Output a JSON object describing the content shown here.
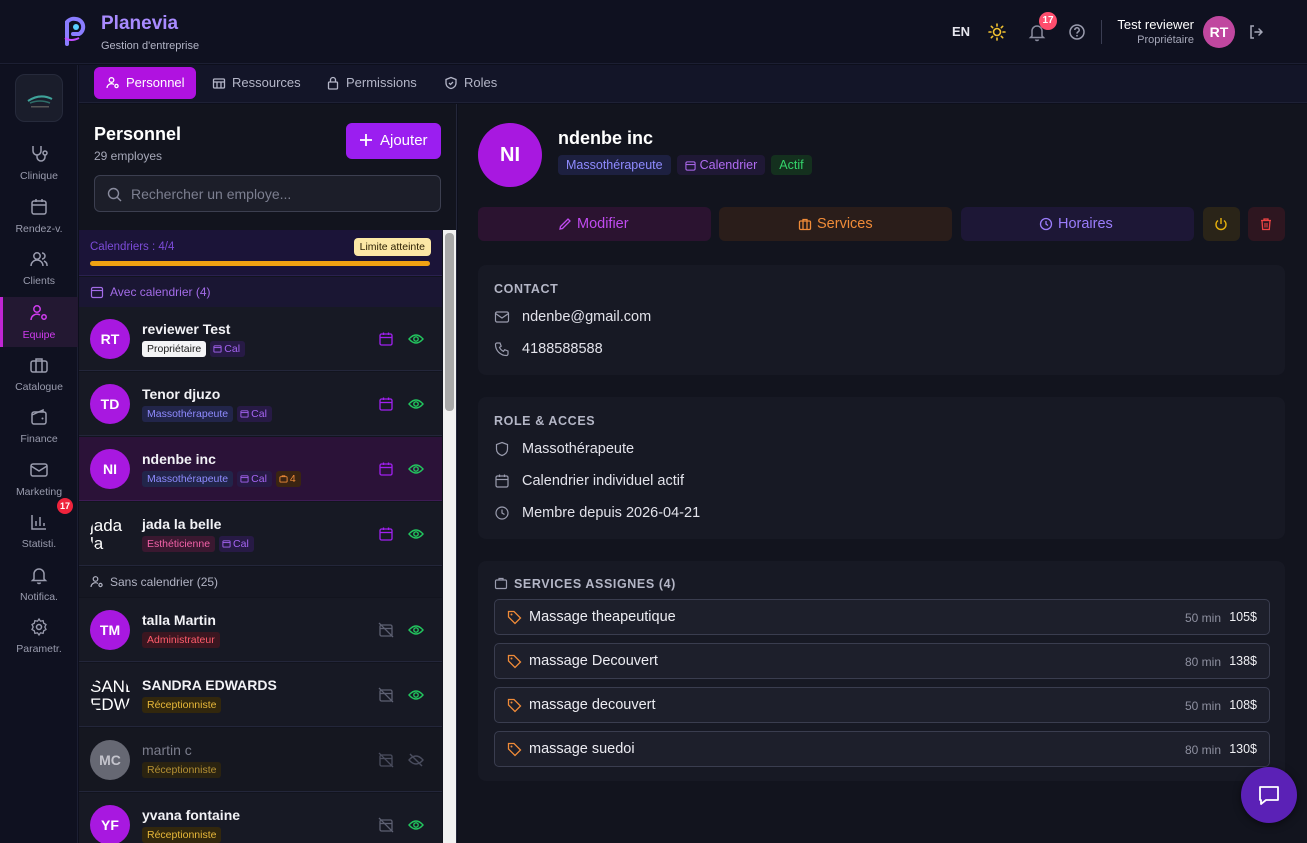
{
  "app": {
    "brand_name": "Planevia",
    "brand_sub": "Gestion d'entreprise"
  },
  "topbar": {
    "lang": "EN",
    "notif_count": "17",
    "user_name": "Test reviewer",
    "user_role": "Propriétaire",
    "user_initials": "RT"
  },
  "leftnav": {
    "items": [
      {
        "label": "Clinique",
        "icon": "stethoscope-icon"
      },
      {
        "label": "Rendez-v.",
        "icon": "calendar-icon"
      },
      {
        "label": "Clients",
        "icon": "users-icon"
      },
      {
        "label": "Equipe",
        "icon": "team-gear-icon"
      },
      {
        "label": "Catalogue",
        "icon": "briefcase-icon"
      },
      {
        "label": "Finance",
        "icon": "wallet-icon"
      },
      {
        "label": "Marketing",
        "icon": "mail-icon"
      },
      {
        "label": "Statisti.",
        "icon": "bar-chart-icon"
      },
      {
        "label": "Notifica.",
        "icon": "bell-icon"
      },
      {
        "label": "Parametr.",
        "icon": "gear-icon"
      }
    ],
    "notif_badge": "17",
    "active": "Equipe"
  },
  "tabs": [
    {
      "label": "Personnel",
      "icon": "user-gear-icon",
      "active": true
    },
    {
      "label": "Ressources",
      "icon": "building-icon",
      "active": false
    },
    {
      "label": "Permissions",
      "icon": "lock-icon",
      "active": false
    },
    {
      "label": "Roles",
      "icon": "shield-icon",
      "active": false
    }
  ],
  "list": {
    "title": "Personnel",
    "count": "29 employes",
    "add_label": "Ajouter",
    "search_placeholder": "Rechercher un employe...",
    "cal_limit_text": "Calendriers : 4/4",
    "cal_limit_badge": "Limite atteinte",
    "cal_limit_fill": 1.0,
    "section_cal": "Avec calendrier (4)",
    "section_nocal": "Sans calendrier (25)",
    "cal_tag": "Cal",
    "employees_cal": [
      {
        "initials": "RT",
        "name": "reviewer Test",
        "role": "Propriétaire",
        "svc": ""
      },
      {
        "initials": "TD",
        "name": "Tenor djuzo",
        "role": "Massothérapeute",
        "svc": ""
      },
      {
        "initials": "NI",
        "name": "ndenbe inc",
        "role": "Massothérapeute",
        "svc": "4"
      },
      {
        "initials": "jada la belle",
        "name": "jada la belle",
        "role": "Esthéticienne",
        "svc": ""
      }
    ],
    "employees_nocal": [
      {
        "initials": "TM",
        "name": "talla Martin",
        "role": "Administrateur"
      },
      {
        "initials": "SANDRA EDWARDS",
        "name": "SANDRA EDWARDS",
        "role": "Réceptionniste"
      },
      {
        "initials": "MC",
        "name": "martin c",
        "role": "Réceptionniste"
      },
      {
        "initials": "YF",
        "name": "yvana fontaine",
        "role": "Réceptionniste"
      }
    ]
  },
  "detail": {
    "initials": "NI",
    "name": "ndenbe inc",
    "role_tag": "Massothérapeute",
    "cal_tag": "Calendrier",
    "status_tag": "Actif",
    "btn_edit": "Modifier",
    "btn_services": "Services",
    "btn_hours": "Horaires",
    "contact_heading": "CONTACT",
    "email": "ndenbe@gmail.com",
    "phone": "4188588588",
    "role_heading": "ROLE & ACCES",
    "role": "Massothérapeute",
    "calendar_status": "Calendrier individuel actif",
    "member_since": "Membre depuis 2026-04-21",
    "services_heading": "SERVICES ASSIGNES (4)",
    "services": [
      {
        "name": "Massage theapeutique",
        "duration": "50 min",
        "price": "105$"
      },
      {
        "name": "massage Decouvert",
        "duration": "80 min",
        "price": "138$"
      },
      {
        "name": "massage decouvert",
        "duration": "50 min",
        "price": "108$"
      },
      {
        "name": "massage suedoi",
        "duration": "80 min",
        "price": "130$"
      }
    ]
  },
  "colors": {
    "accent": "#a818e0",
    "brand": "#a98bff",
    "active_green": "#34d36a",
    "warning": "#f0a212"
  }
}
